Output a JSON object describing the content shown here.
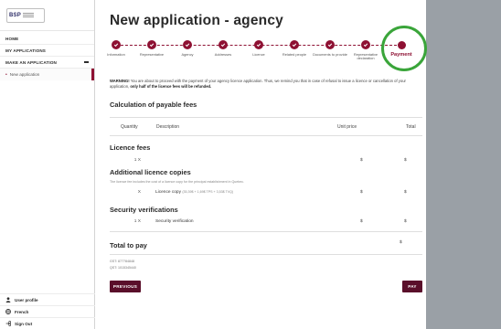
{
  "sidebar": {
    "logo_text": "BSP",
    "items": [
      {
        "label": "HOME"
      },
      {
        "label": "MY APPLICATIONS"
      },
      {
        "label": "MAKE AN APPLICATION"
      }
    ],
    "sub_item": "New application",
    "bottom": [
      {
        "label": "User profile",
        "icon": "user-icon"
      },
      {
        "label": "French",
        "icon": "globe-icon"
      },
      {
        "label": "Sign Out",
        "icon": "sign-out-icon"
      }
    ]
  },
  "main": {
    "title": "New application - agency",
    "steps": [
      {
        "label": "Information"
      },
      {
        "label": "Representative"
      },
      {
        "label": "Agency"
      },
      {
        "label": "Addresses"
      },
      {
        "label": "Licence"
      },
      {
        "label": "Related people"
      },
      {
        "label": "Documents to provide"
      },
      {
        "label": "Representative declaration"
      },
      {
        "label": "Payment"
      }
    ],
    "warning_prefix": "WARNING!",
    "warning_text": "You are about to proceed with the payment of your agency licence application. Thus, we remind you that in case of refusal to issue a licence or cancellation of your application,",
    "warning_bold": "only half of the licence fees will be refunded.",
    "calc_title": "Calculation of payable fees",
    "columns": {
      "quantity": "Quantity",
      "description": "Description",
      "unit_price": "Unit price",
      "total": "Total"
    },
    "licence_fees_title": "Licence fees",
    "licence_qty": "1 X",
    "additional_title": "Additional licence copies",
    "additional_note": "The licence fee includes the cost of a licence copy for the principal establishment in Quebec.",
    "copy_qty": "X",
    "copy_desc": "Licence copy",
    "copy_price_note": "(35,39$ + 1,69$ TPS + 3,53$ TVQ)",
    "security_title": "Security verifications",
    "security_qty": "1 X",
    "security_desc": "Security verification",
    "currency": "$",
    "total_label": "Total to pay",
    "tax_gst": "GST: 877784848",
    "tax_qst": "QST: 1015345440",
    "previous_label": "PREVIOUS",
    "pay_label": "PAY"
  },
  "colors": {
    "accent": "#8e1133",
    "button": "#5a0f2a",
    "focus_ring": "#3aa53a"
  }
}
